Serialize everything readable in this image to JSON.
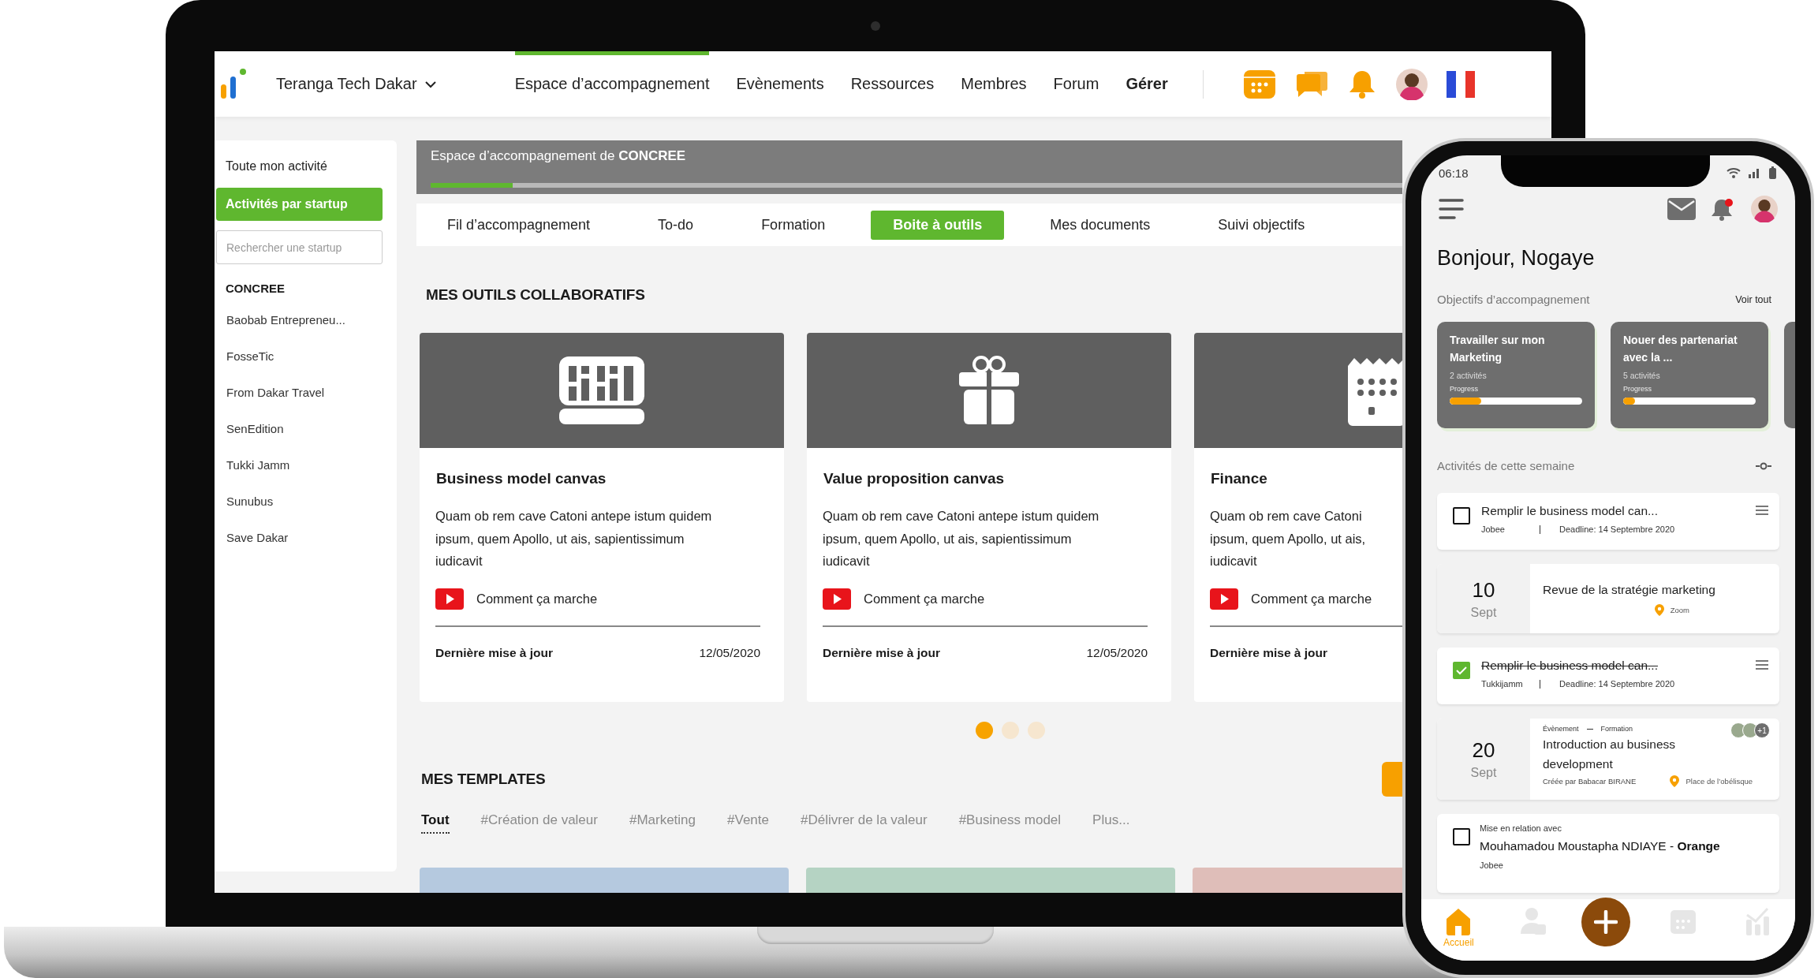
{
  "laptop": {
    "header": {
      "workspace": "Teranga Tech Dakar",
      "nav": [
        {
          "label": "Espace d’accompagnement",
          "selected": true,
          "emphasized": false
        },
        {
          "label": "Evènements",
          "selected": false,
          "emphasized": false
        },
        {
          "label": "Ressources",
          "selected": false,
          "emphasized": false
        },
        {
          "label": "Membres",
          "selected": false,
          "emphasized": false
        },
        {
          "label": "Forum",
          "selected": false,
          "emphasized": false
        },
        {
          "label": "Gérer",
          "selected": false,
          "emphasized": true
        }
      ]
    },
    "sidebar": {
      "items": [
        {
          "label": "Toute mon activité",
          "selected": false
        },
        {
          "label": "Activités par startup",
          "selected": true
        }
      ],
      "search": {
        "placeholder": "Rechercher une startup"
      },
      "group": "CONCREE",
      "startups": [
        "Baobab Entrepreneu...",
        "FosseTic",
        "From Dakar Travel",
        "SenEdition",
        "Tukki Jamm",
        "Sunubus",
        "Save Dakar"
      ]
    },
    "banner": {
      "title": "Espace d’accompagnement de **CONCREE**",
      "level": 0.07
    },
    "tabs": [
      {
        "label": "Fil d’accompagnement",
        "selected": false
      },
      {
        "label": "To-do",
        "selected": false
      },
      {
        "label": "Formation",
        "selected": false
      },
      {
        "label": "Boite à outils",
        "selected": true
      },
      {
        "label": "Mes documents",
        "selected": false
      },
      {
        "label": "Suivi objectifs",
        "selected": false
      }
    ],
    "tools": {
      "title": "MES OUTILS COLLABORATIFS",
      "cards": [
        {
          "title": "Business model canvas",
          "description": [
            "Quam ob rem cave Catoni antepe istum quidem",
            "ipsum, quem Apollo, ut ais, sapientissimum",
            "iudicavit"
          ],
          "link": "Comment ça marche",
          "footer_label": "Dernière mise à jour",
          "date": "12/05/2020"
        },
        {
          "title": "Value proposition canvas",
          "description": [
            "Quam ob rem cave Catoni antepe istum quidem",
            "ipsum, quem Apollo, ut ais, sapientissimum",
            "iudicavit"
          ],
          "link": "Comment ça marche",
          "footer_label": "Dernière mise à jour",
          "date": "12/05/2020"
        },
        {
          "title": "Finance",
          "description": [
            "Quam ob rem cave Catoni",
            "ipsum, quem Apollo, ut ais,",
            "iudicavit"
          ],
          "link": "Comment ça marche",
          "footer_label": "Dernière mise à jour"
        }
      ],
      "pager": [
        {
          "selected": true
        },
        {
          "selected": false
        },
        {
          "selected": false
        }
      ]
    },
    "templates": {
      "title": "MES TEMPLATES",
      "tags": [
        {
          "label": "Tout",
          "selected": true
        },
        {
          "label": "#Création de valeur",
          "selected": false
        },
        {
          "label": "#Marketing",
          "selected": false
        },
        {
          "label": "#Vente",
          "selected": false
        },
        {
          "label": "#Délivrer de la valeur",
          "selected": false
        },
        {
          "label": "#Business model",
          "selected": false
        },
        {
          "label": "Plus...",
          "selected": false
        }
      ],
      "previews": [
        {
          "color": "#b5c9df"
        },
        {
          "color": "#b5d3c3"
        },
        {
          "color": "#dfbeb9"
        }
      ]
    }
  },
  "phone": {
    "status_time": "06:18",
    "greeting": "Bonjour, Nogaye",
    "objectives": {
      "title": "Objectifs d’accompagnement",
      "link": "Voir tout",
      "items": [
        {
          "title": "Travailler sur mon Marketing",
          "count": "2 activités",
          "progress_label": "Progress",
          "level": 0.24
        },
        {
          "title": "Nouer des partenariat avec la ...",
          "count": "5 activités",
          "progress_label": "Progress",
          "level": 0.09
        }
      ]
    },
    "week": {
      "title": "Activités de cette semaine",
      "items": [
        {
          "kind": "task",
          "checked": false,
          "title": "Remplir le business model can...",
          "owner": "Jobee",
          "deadline": "Deadline: 14 Septembre 2020"
        },
        {
          "kind": "event",
          "day": "10",
          "month": "Sept",
          "title": "Revue de la stratégie marketing",
          "location": "Zoom"
        },
        {
          "kind": "task",
          "checked": true,
          "title": "Remplir le business model can...",
          "owner": "Tukkijamm",
          "deadline": "Deadline: 14 Septembre 2020"
        },
        {
          "kind": "event",
          "day": "20",
          "month": "Sept",
          "category": "Évènement",
          "type": "Formation",
          "title": "Introduction au business development",
          "creator": "Créée par Babacar BIRANE",
          "location": "Place de l’obélisque",
          "extra": "+1"
        },
        {
          "kind": "contact",
          "checked": false,
          "label": "Mise en relation avec",
          "name": "Mouhamadou Moustapha NDIAYE - **Orange**",
          "owner": "Jobee"
        }
      ]
    },
    "nav": [
      {
        "label": "Accueil",
        "selected": true
      },
      {
        "selected": false
      },
      {
        "selected": false
      },
      {
        "selected": false
      }
    ]
  }
}
